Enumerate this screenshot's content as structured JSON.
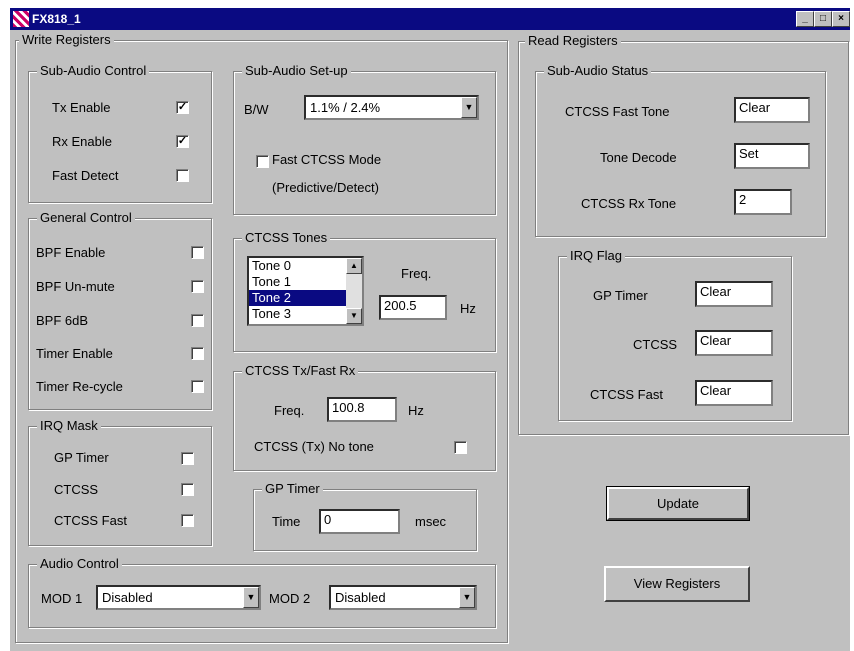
{
  "window": {
    "title": "FX818_1",
    "buttons": [
      "_",
      "□",
      "×"
    ]
  },
  "write_group": {
    "label": "Write Registers"
  },
  "sub_audio_control": {
    "label": "Sub-Audio Control",
    "tx_enable": {
      "label": "Tx Enable",
      "mark": "✓"
    },
    "rx_enable": {
      "label": "Rx Enable",
      "mark": "✓"
    },
    "fast_detect": {
      "label": "Fast Detect",
      "mark": ""
    }
  },
  "sub_audio_setup": {
    "label": "Sub-Audio Set-up",
    "bw_label": "B/W",
    "bw_value": "1.1% / 2.4%",
    "fast_ctcss_label": "Fast CTCSS Mode",
    "fast_ctcss_sub": "(Predictive/Detect)",
    "fast_ctcss_mark": ""
  },
  "general_control": {
    "label": "General Control",
    "items": [
      {
        "label": "BPF Enable",
        "mark": ""
      },
      {
        "label": "BPF Un-mute",
        "mark": ""
      },
      {
        "label": "BPF 6dB",
        "mark": ""
      },
      {
        "label": "Timer Enable",
        "mark": ""
      },
      {
        "label": "Timer Re-cycle",
        "mark": ""
      }
    ]
  },
  "ctcss_tones": {
    "label": "CTCSS Tones",
    "tones": [
      "Tone 0",
      "Tone 1",
      "Tone 2",
      "Tone 3"
    ],
    "selected": "Tone 2",
    "freq_label": "Freq.",
    "freq_value": "200.5",
    "unit": "Hz"
  },
  "ctcss_tx": {
    "label": "CTCSS Tx/Fast Rx",
    "freq_label": "Freq.",
    "freq_value": "100.8",
    "unit": "Hz",
    "no_tone_label": "CTCSS (Tx) No tone",
    "no_tone_mark": ""
  },
  "irq_mask": {
    "label": "IRQ Mask",
    "items": [
      {
        "label": "GP Timer",
        "mark": ""
      },
      {
        "label": "CTCSS",
        "mark": ""
      },
      {
        "label": "CTCSS Fast",
        "mark": ""
      }
    ]
  },
  "gp_timer": {
    "label": "GP Timer",
    "time_label": "Time",
    "time_value": "0",
    "unit": "msec"
  },
  "audio_control": {
    "label": "Audio Control",
    "mod1_label": "MOD 1",
    "mod1_value": "Disabled",
    "mod2_label": "MOD 2",
    "mod2_value": "Disabled"
  },
  "read_group": {
    "label": "Read Registers"
  },
  "sub_audio_status": {
    "label": "Sub-Audio Status",
    "fast_tone_label": "CTCSS Fast Tone",
    "fast_tone_value": "Clear",
    "tone_decode_label": "Tone Decode",
    "tone_decode_value": "Set",
    "rx_tone_label": "CTCSS Rx Tone",
    "rx_tone_value": "2"
  },
  "irq_flag": {
    "label": "IRQ Flag",
    "gp_timer_label": "GP Timer",
    "gp_timer_value": "Clear",
    "ctcss_label": "CTCSS",
    "ctcss_value": "Clear",
    "ctcss_fast_label": "CTCSS Fast",
    "ctcss_fast_value": "Clear"
  },
  "buttons": {
    "update": "Update",
    "view_registers": "View Registers"
  },
  "icons": {
    "dropdown": "▼",
    "scroll_up": "▲",
    "scroll_down": "▼"
  }
}
